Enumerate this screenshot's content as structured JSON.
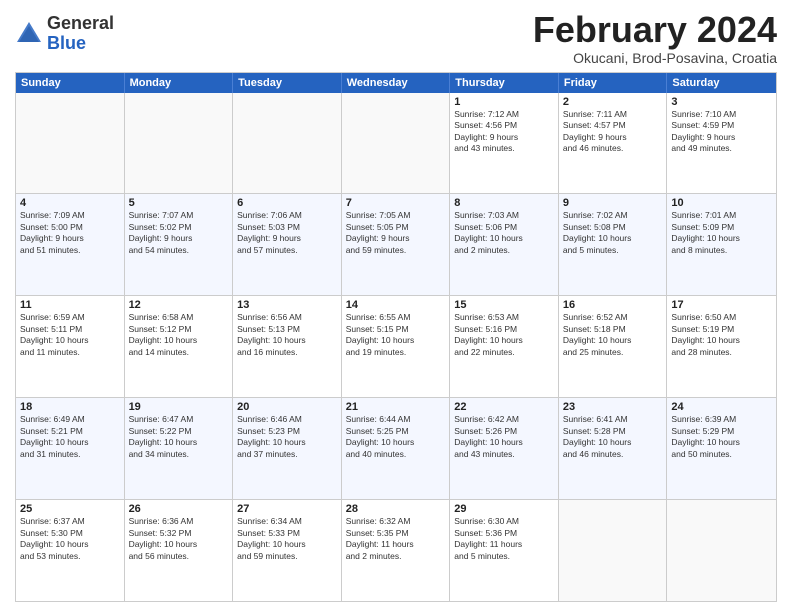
{
  "header": {
    "logo_general": "General",
    "logo_blue": "Blue",
    "month_title": "February 2024",
    "subtitle": "Okucani, Brod-Posavina, Croatia"
  },
  "calendar": {
    "days_of_week": [
      "Sunday",
      "Monday",
      "Tuesday",
      "Wednesday",
      "Thursday",
      "Friday",
      "Saturday"
    ],
    "rows": [
      [
        {
          "day": "",
          "info": ""
        },
        {
          "day": "",
          "info": ""
        },
        {
          "day": "",
          "info": ""
        },
        {
          "day": "",
          "info": ""
        },
        {
          "day": "1",
          "info": "Sunrise: 7:12 AM\nSunset: 4:56 PM\nDaylight: 9 hours\nand 43 minutes."
        },
        {
          "day": "2",
          "info": "Sunrise: 7:11 AM\nSunset: 4:57 PM\nDaylight: 9 hours\nand 46 minutes."
        },
        {
          "day": "3",
          "info": "Sunrise: 7:10 AM\nSunset: 4:59 PM\nDaylight: 9 hours\nand 49 minutes."
        }
      ],
      [
        {
          "day": "4",
          "info": "Sunrise: 7:09 AM\nSunset: 5:00 PM\nDaylight: 9 hours\nand 51 minutes."
        },
        {
          "day": "5",
          "info": "Sunrise: 7:07 AM\nSunset: 5:02 PM\nDaylight: 9 hours\nand 54 minutes."
        },
        {
          "day": "6",
          "info": "Sunrise: 7:06 AM\nSunset: 5:03 PM\nDaylight: 9 hours\nand 57 minutes."
        },
        {
          "day": "7",
          "info": "Sunrise: 7:05 AM\nSunset: 5:05 PM\nDaylight: 9 hours\nand 59 minutes."
        },
        {
          "day": "8",
          "info": "Sunrise: 7:03 AM\nSunset: 5:06 PM\nDaylight: 10 hours\nand 2 minutes."
        },
        {
          "day": "9",
          "info": "Sunrise: 7:02 AM\nSunset: 5:08 PM\nDaylight: 10 hours\nand 5 minutes."
        },
        {
          "day": "10",
          "info": "Sunrise: 7:01 AM\nSunset: 5:09 PM\nDaylight: 10 hours\nand 8 minutes."
        }
      ],
      [
        {
          "day": "11",
          "info": "Sunrise: 6:59 AM\nSunset: 5:11 PM\nDaylight: 10 hours\nand 11 minutes."
        },
        {
          "day": "12",
          "info": "Sunrise: 6:58 AM\nSunset: 5:12 PM\nDaylight: 10 hours\nand 14 minutes."
        },
        {
          "day": "13",
          "info": "Sunrise: 6:56 AM\nSunset: 5:13 PM\nDaylight: 10 hours\nand 16 minutes."
        },
        {
          "day": "14",
          "info": "Sunrise: 6:55 AM\nSunset: 5:15 PM\nDaylight: 10 hours\nand 19 minutes."
        },
        {
          "day": "15",
          "info": "Sunrise: 6:53 AM\nSunset: 5:16 PM\nDaylight: 10 hours\nand 22 minutes."
        },
        {
          "day": "16",
          "info": "Sunrise: 6:52 AM\nSunset: 5:18 PM\nDaylight: 10 hours\nand 25 minutes."
        },
        {
          "day": "17",
          "info": "Sunrise: 6:50 AM\nSunset: 5:19 PM\nDaylight: 10 hours\nand 28 minutes."
        }
      ],
      [
        {
          "day": "18",
          "info": "Sunrise: 6:49 AM\nSunset: 5:21 PM\nDaylight: 10 hours\nand 31 minutes."
        },
        {
          "day": "19",
          "info": "Sunrise: 6:47 AM\nSunset: 5:22 PM\nDaylight: 10 hours\nand 34 minutes."
        },
        {
          "day": "20",
          "info": "Sunrise: 6:46 AM\nSunset: 5:23 PM\nDaylight: 10 hours\nand 37 minutes."
        },
        {
          "day": "21",
          "info": "Sunrise: 6:44 AM\nSunset: 5:25 PM\nDaylight: 10 hours\nand 40 minutes."
        },
        {
          "day": "22",
          "info": "Sunrise: 6:42 AM\nSunset: 5:26 PM\nDaylight: 10 hours\nand 43 minutes."
        },
        {
          "day": "23",
          "info": "Sunrise: 6:41 AM\nSunset: 5:28 PM\nDaylight: 10 hours\nand 46 minutes."
        },
        {
          "day": "24",
          "info": "Sunrise: 6:39 AM\nSunset: 5:29 PM\nDaylight: 10 hours\nand 50 minutes."
        }
      ],
      [
        {
          "day": "25",
          "info": "Sunrise: 6:37 AM\nSunset: 5:30 PM\nDaylight: 10 hours\nand 53 minutes."
        },
        {
          "day": "26",
          "info": "Sunrise: 6:36 AM\nSunset: 5:32 PM\nDaylight: 10 hours\nand 56 minutes."
        },
        {
          "day": "27",
          "info": "Sunrise: 6:34 AM\nSunset: 5:33 PM\nDaylight: 10 hours\nand 59 minutes."
        },
        {
          "day": "28",
          "info": "Sunrise: 6:32 AM\nSunset: 5:35 PM\nDaylight: 11 hours\nand 2 minutes."
        },
        {
          "day": "29",
          "info": "Sunrise: 6:30 AM\nSunset: 5:36 PM\nDaylight: 11 hours\nand 5 minutes."
        },
        {
          "day": "",
          "info": ""
        },
        {
          "day": "",
          "info": ""
        }
      ]
    ]
  }
}
